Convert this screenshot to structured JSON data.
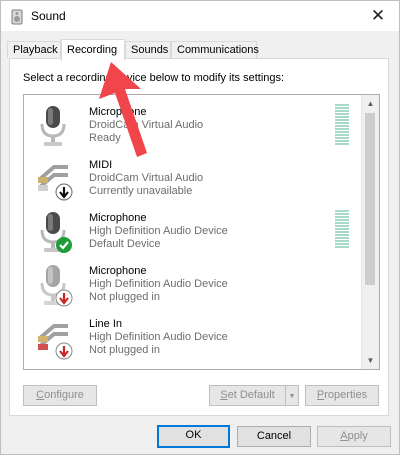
{
  "window": {
    "title": "Sound",
    "close_label": "✕"
  },
  "tabs": [
    {
      "label": "Playback"
    },
    {
      "label": "Recording"
    },
    {
      "label": "Sounds"
    },
    {
      "label": "Communications"
    }
  ],
  "instruction": "Select a recording device below to modify its settings:",
  "devices": [
    {
      "name": "Microphone",
      "driver": "DroidCam Virtual Audio",
      "status": "Ready",
      "badge": "none",
      "icon": "microphone-icon",
      "meter": true
    },
    {
      "name": "MIDI",
      "driver": "DroidCam Virtual Audio",
      "status": "Currently unavailable",
      "badge": "black-down-arrow",
      "icon": "line-in-icon",
      "meter": false
    },
    {
      "name": "Microphone",
      "driver": "High Definition Audio Device",
      "status": "Default Device",
      "badge": "green-check",
      "icon": "microphone-icon",
      "meter": true
    },
    {
      "name": "Microphone",
      "driver": "High Definition Audio Device",
      "status": "Not plugged in",
      "badge": "red-down-arrow",
      "icon": "microphone-icon",
      "meter": false
    },
    {
      "name": "Line In",
      "driver": "High Definition Audio Device",
      "status": "Not plugged in",
      "badge": "red-down-arrow",
      "icon": "line-in-icon",
      "meter": false
    }
  ],
  "buttons": {
    "configure": {
      "underline": "C",
      "rest": "onfigure",
      "enabled": false
    },
    "set_default": {
      "underline": "S",
      "rest": "et Default",
      "enabled": false
    },
    "properties": {
      "underline": "P",
      "rest": "roperties",
      "enabled": false
    },
    "ok": "OK",
    "cancel": "Cancel",
    "apply": {
      "underline": "A",
      "rest": "pply",
      "enabled": false
    }
  },
  "colors": {
    "accent": "#0078d7",
    "annotation_arrow": "#f0454b",
    "meter": "#a9dac8",
    "check_green": "#1e9c3a",
    "badge_red": "#c62828"
  }
}
